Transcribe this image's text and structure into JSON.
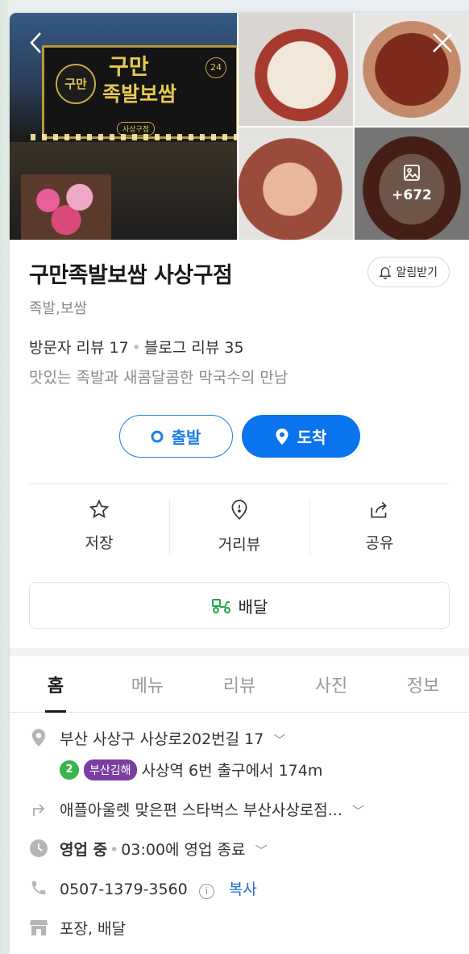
{
  "photos": {
    "sign_logo_text": "구만",
    "sign_title_line1": "구만",
    "sign_title_line2": "족발보쌈",
    "sign_badge": "24",
    "sign_branch": "사상구점",
    "more_count": "+672"
  },
  "place": {
    "title": "구만족발보쌈 사상구점",
    "category": "족발,보쌈",
    "visitor_reviews": "방문자 리뷰 17",
    "blog_reviews": "블로그 리뷰 35",
    "tagline": "맛있는 족발과 새콤달콤한 막국수의 만남",
    "alarm_label": "알림받기"
  },
  "route": {
    "start_label": "출발",
    "end_label": "도착"
  },
  "actions": {
    "save_label": "저장",
    "roadview_label": "거리뷰",
    "share_label": "공유",
    "delivery_label": "배달"
  },
  "tabs": [
    {
      "label": "홈"
    },
    {
      "label": "메뉴"
    },
    {
      "label": "리뷰"
    },
    {
      "label": "사진"
    },
    {
      "label": "정보"
    }
  ],
  "details": {
    "address": "부산 사상구 사상로202번길 17",
    "subway_line": "2",
    "subway_line_name": "부산김해",
    "subway_text": "사상역 6번 출구에서 174m",
    "direction": "애플아울렛 맞은편 스타벅스 부산사상로점...",
    "hours_status": "영업 중",
    "hours_end": "03:00에 영업 종료",
    "phone": "0507-1379-3560",
    "copy_label": "복사",
    "services": "포장, 배달"
  },
  "colors": {
    "accent_blue": "#0a74ef",
    "delivery_green": "#1fa84a",
    "subway_green": "#3cb44b",
    "subway_purple": "#7a3fa0"
  }
}
